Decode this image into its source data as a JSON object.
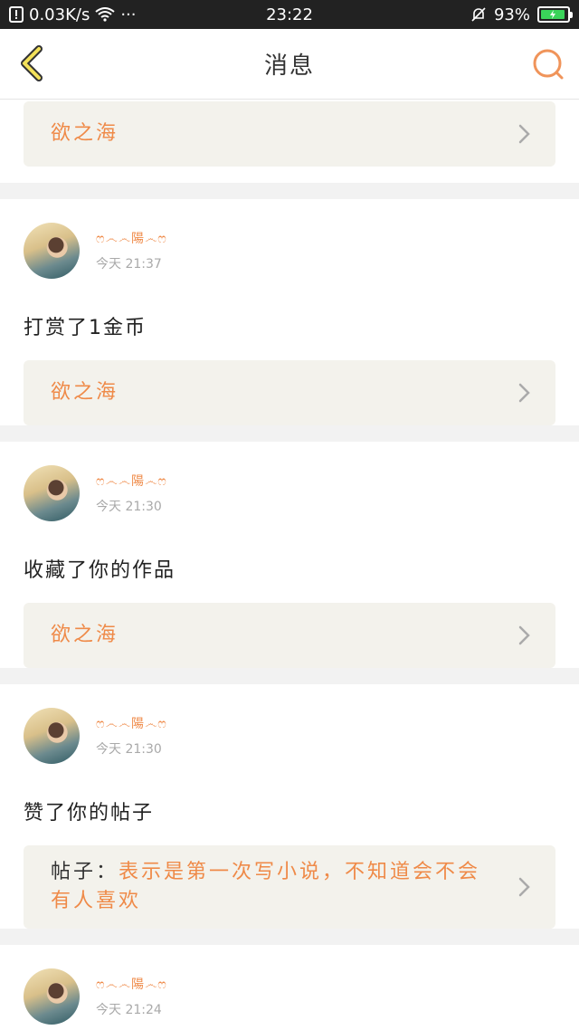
{
  "status_bar": {
    "network_speed": "0.03K/s",
    "more": "···",
    "time": "23:22",
    "battery": "93%"
  },
  "header": {
    "title": "消息"
  },
  "messages": [
    {
      "quote": "欲之海"
    },
    {
      "username": "ෆ෴෴陽෴ෆ",
      "time": "今天 21:37",
      "action": "打赏了1金币",
      "quote": "欲之海"
    },
    {
      "username": "ෆ෴෴陽෴ෆ",
      "time": "今天 21:30",
      "action": "收藏了你的作品",
      "quote": "欲之海"
    },
    {
      "username": "ෆ෴෴陽෴ෆ",
      "time": "今天 21:30",
      "action": "赞了你的帖子",
      "quote_prefix": "帖子：",
      "quote": "表示是第一次写小说，不知道会不会有人喜欢"
    },
    {
      "username": "ෆ෴෴陽෴ෆ",
      "time": "今天 21:24"
    }
  ]
}
